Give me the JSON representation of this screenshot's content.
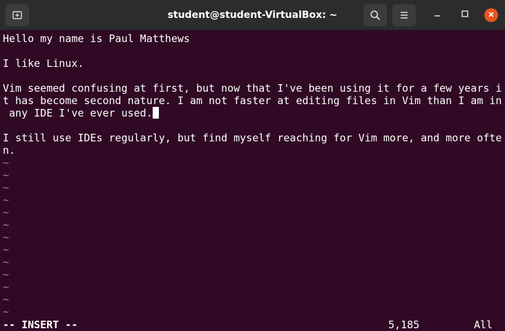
{
  "window": {
    "title": "student@student-VirtualBox: ~",
    "accent_close": "#e95420",
    "terminal_background": "#300a24"
  },
  "titlebar_icons": {
    "new_tab": "new-tab-icon",
    "search": "search-icon",
    "menu": "hamburger-menu-icon",
    "minimize": "minimize-icon",
    "maximize": "maximize-icon",
    "close": "close-icon"
  },
  "buffer": {
    "lines": [
      "Hello my name is Paul Matthews",
      "",
      "I like Linux.",
      "",
      "Vim seemed confusing at first, but now that I've been using it for a few years i",
      "t has become second nature. I am not faster at editing files in Vim than I am in",
      " any IDE I've ever used.",
      "",
      "I still use IDEs regularly, but find myself reaching for Vim more, and more ofte",
      "n."
    ],
    "empty_marker": "~"
  },
  "statusline": {
    "mode": "-- INSERT --",
    "position": "5,185",
    "scroll": "All"
  }
}
